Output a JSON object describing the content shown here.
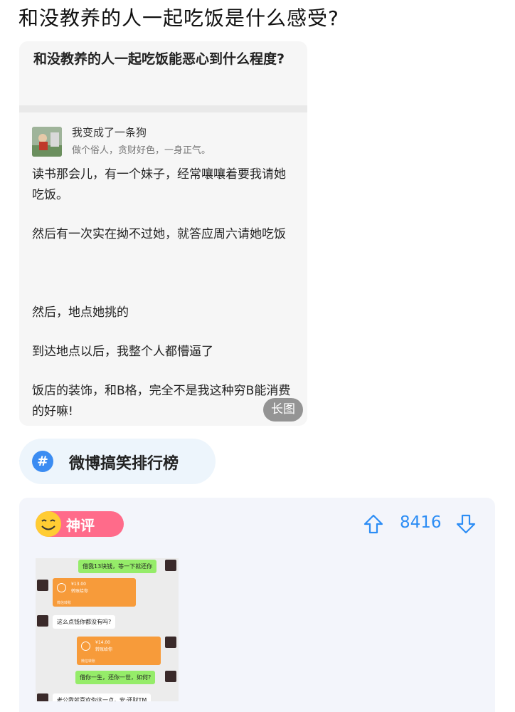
{
  "post": {
    "title": "和没教养的人一起吃饭是什么感受?"
  },
  "long_image": {
    "question": "和没教养的人一起吃饭能恶心到什么程度?",
    "user_name": "我变成了一条狗",
    "user_bio": "做个俗人，贪财好色，一身正气。",
    "paragraphs": [
      "读书那会儿，有一个妹子，经常嚷嚷着要我请她吃饭。",
      "然后有一次实在拗不过她，就答应周六请她吃饭",
      "然后，地点她挑的",
      "到达地点以后，我整个人都懵逼了",
      "饭店的装饰，和B格，完全不是我这种穷B能消费的好嘛!"
    ],
    "badge": "长图"
  },
  "topic": {
    "icon": "#",
    "label": "微博搞笑排行榜"
  },
  "comment": {
    "tag": "神评",
    "votes": "8416",
    "chat": {
      "msg1": "借我13块钱，等一下就还你",
      "rp1_amount": "¥13.00",
      "rp1_sub": "转账给你",
      "rp_foot": "微信转账",
      "msg2": "这么点钱你都没有吗?",
      "rp2_amount": "¥14.00",
      "rp2_sub": "转账给你",
      "msg3": "借你一生，还你一世，如何?",
      "msg4": "老公我就喜欢你这一点，安·还财TM"
    }
  },
  "colors": {
    "accent_blue": "#2c8df5",
    "shenping_pink": "#ff6b8a",
    "redpacket_orange": "#f79b3a",
    "wechat_green": "#95ec69"
  }
}
